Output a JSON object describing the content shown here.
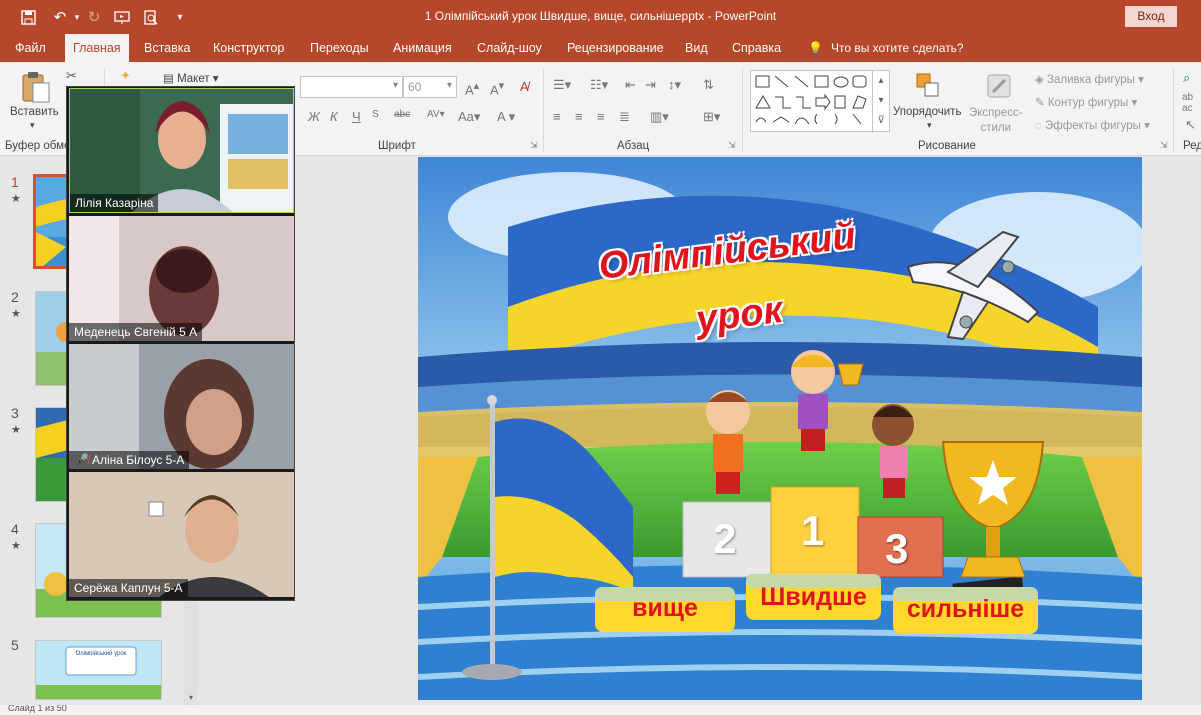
{
  "quick_access": {
    "save_icon": "save-icon",
    "undo_icon": "undo-icon",
    "redo_icon": "redo-icon",
    "present_icon": "present-icon",
    "preview_icon": "preview-icon",
    "customize_icon": "customize-icon"
  },
  "window": {
    "title": "1 Олімпійський урок Швидше, вище, сильнішеpptx  -  PowerPoint",
    "signin_label": "Вход"
  },
  "tabs": [
    "Файл",
    "Главная",
    "Вставка",
    "Конструктор",
    "Переходы",
    "Анимация",
    "Слайд-шоу",
    "Рецензирование",
    "Вид",
    "Справка"
  ],
  "active_tab": "Главная",
  "tell_me": "Что вы хотите сделать?",
  "ribbon": {
    "paste_label": "Вставить",
    "layout_label": "Макет",
    "font_size": "60",
    "arrange_label": "Упорядочить",
    "quick_styles_label": "Экспресс-\nстили",
    "shape_fill": "Заливка фигуры",
    "shape_outline": "Контур фигуры",
    "shape_effects": "Эффекты фигуры",
    "groups": {
      "clipboard": "Буфер обме",
      "font": "Шрифт",
      "paragraph": "Абзац",
      "drawing": "Рисование",
      "editing": "Ред"
    }
  },
  "thumbnails": [
    {
      "num": "1",
      "star": "★"
    },
    {
      "num": "2",
      "star": "★"
    },
    {
      "num": "3",
      "star": "★"
    },
    {
      "num": "4",
      "star": "★"
    },
    {
      "num": "5",
      "star": ""
    }
  ],
  "thumb5_text": "Олімпійський урок",
  "slide": {
    "title_line1": "Олімпійський",
    "title_line2": "урок",
    "podium": [
      "2",
      "1",
      "3"
    ],
    "badges": [
      "вище",
      "Швидше",
      "сильніше"
    ]
  },
  "participants": [
    {
      "name": "Лілія Казаріна",
      "muted": false
    },
    {
      "name": "Меденець Євгеній 5 А",
      "muted": false
    },
    {
      "name": "Аліна Білоус 5-А",
      "muted": true
    },
    {
      "name": "Серёжа Каплун 5-А",
      "muted": false
    }
  ],
  "status": {
    "slide_info": "Слайд 1 из 50"
  },
  "colors": {
    "accent": "#b7472a",
    "title_red": "#e0141c",
    "badge_bg": "#ffd82e"
  }
}
